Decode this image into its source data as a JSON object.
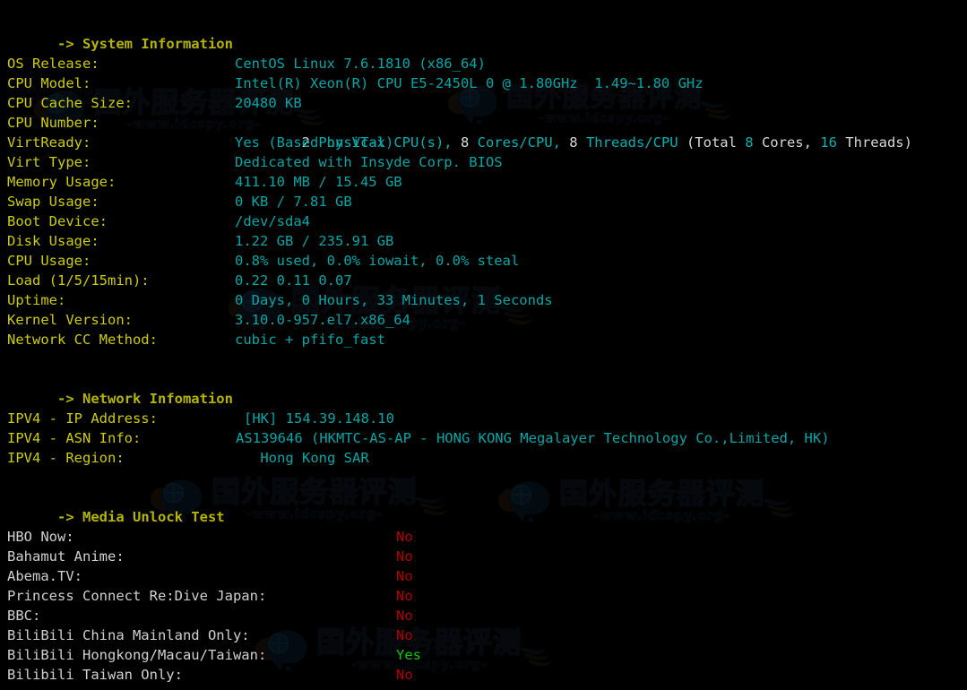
{
  "terminal": {
    "background": "#000000",
    "colors": {
      "header": "#b5b500",
      "label": "#cdcd00",
      "value": "#00a8a8",
      "white": "#d8d8d8",
      "yes": "#00cc00",
      "no": "#b00000"
    }
  },
  "watermark": {
    "cn_text": "国外服务器评测",
    "url_text": "-www.idcspy.org-",
    "logo_name": "cloud-globe-logo"
  },
  "sections": [
    {
      "heading": "-> System Information",
      "rows": [
        {
          "label": "OS Release:",
          "value": "CentOS Linux 7.6.1810 (x86_64)"
        },
        {
          "label": "CPU Model:",
          "value": "Intel(R) Xeon(R) CPU E5-2450L 0 @ 1.80GHz  1.49~1.80 GHz"
        },
        {
          "label": "CPU Cache Size:",
          "value": "20480 KB"
        },
        {
          "label": "CPU Number:",
          "value": "2 Physical CPU(s), 8 Cores/CPU, 8 Threads/CPU (Total 8 Cores, 16 Threads)"
        },
        {
          "label": "VirtReady:",
          "value": "Yes (Based on VT-x)"
        },
        {
          "label": "Virt Type:",
          "value": "Dedicated with Insyde Corp. BIOS"
        },
        {
          "label": "Memory Usage:",
          "value": "411.10 MB / 15.45 GB"
        },
        {
          "label": "Swap Usage:",
          "value": "0 KB / 7.81 GB"
        },
        {
          "label": "Boot Device:",
          "value": "/dev/sda4"
        },
        {
          "label": "Disk Usage:",
          "value": "1.22 GB / 235.91 GB"
        },
        {
          "label": "CPU Usage:",
          "value": "0.8% used, 0.0% iowait, 0.0% steal"
        },
        {
          "label": "Load (1/5/15min):",
          "value": "0.22 0.11 0.07"
        },
        {
          "label": "Uptime:",
          "value": "0 Days, 0 Hours, 33 Minutes, 1 Seconds"
        },
        {
          "label": "Kernel Version:",
          "value": "3.10.0-957.el7.x86_64"
        },
        {
          "label": "Network CC Method:",
          "value": "cubic + pfifo_fast"
        }
      ]
    },
    {
      "heading": "-> Network Infomation",
      "rows": [
        {
          "label": "IPV4 - IP Address:",
          "value": "[HK] 154.39.148.10"
        },
        {
          "label": "IPV4 - ASN Info:",
          "value": "AS139646 (HKMTC-AS-AP - HONG KONG Megalayer Technology Co.,Limited, HK)"
        },
        {
          "label": "IPV4 - Region:",
          "value": " Hong Kong SAR"
        }
      ]
    },
    {
      "heading": "-> Media Unlock Test",
      "rows": [
        {
          "label": "HBO Now:",
          "value": "No",
          "status": "no"
        },
        {
          "label": "Bahamut Anime:",
          "value": "No",
          "status": "no"
        },
        {
          "label": "Abema.TV:",
          "value": "No",
          "status": "no"
        },
        {
          "label": "Princess Connect Re:Dive Japan:",
          "value": "No",
          "status": "no"
        },
        {
          "label": "BBC:",
          "value": "No",
          "status": "no"
        },
        {
          "label": "BiliBili China Mainland Only:",
          "value": "No",
          "status": "no"
        },
        {
          "label": "BiliBili Hongkong/Macau/Taiwan:",
          "value": "Yes",
          "status": "yes"
        },
        {
          "label": "Bilibili Taiwan Only:",
          "value": "No",
          "status": "no"
        }
      ]
    }
  ],
  "cpu_number_segments": [
    {
      "text": "2",
      "tone": "white"
    },
    {
      "text": " Physical CPU(s),",
      "tone": "cyan"
    },
    {
      "text": " 8",
      "tone": "white"
    },
    {
      "text": " Cores/CPU,",
      "tone": "cyan"
    },
    {
      "text": " 8",
      "tone": "white"
    },
    {
      "text": " Threads/CPU",
      "tone": "cyan"
    },
    {
      "text": " (Total",
      "tone": "white"
    },
    {
      "text": " 8",
      "tone": "cyan"
    },
    {
      "text": " Cores,",
      "tone": "white"
    },
    {
      "text": " 16",
      "tone": "cyan"
    },
    {
      "text": " Threads)",
      "tone": "white"
    }
  ]
}
